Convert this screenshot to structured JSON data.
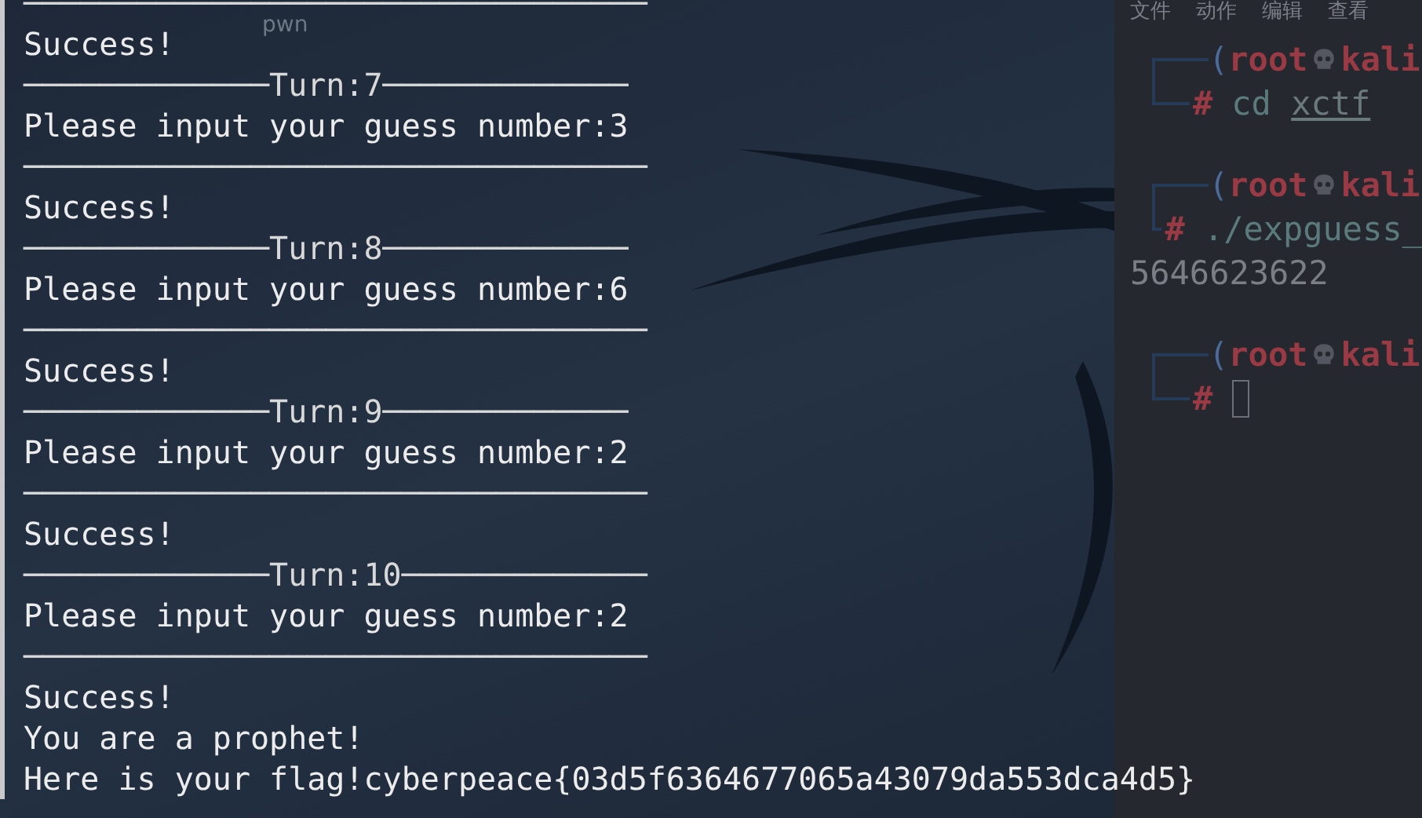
{
  "desktop": {
    "icon_labels": [
      {
        "label": "pwn"
      }
    ]
  },
  "terminal": {
    "lines": [
      {
        "kind": "rule",
        "text": "─────────────────────────────────"
      },
      {
        "kind": "text",
        "text": "Success!"
      },
      {
        "kind": "rule",
        "text": "─────────────Turn:7─────────────"
      },
      {
        "kind": "text",
        "text": "Please input your guess number:3"
      },
      {
        "kind": "rule",
        "text": "─────────────────────────────────"
      },
      {
        "kind": "text",
        "text": "Success!"
      },
      {
        "kind": "rule",
        "text": "─────────────Turn:8─────────────"
      },
      {
        "kind": "text",
        "text": "Please input your guess number:6"
      },
      {
        "kind": "rule",
        "text": "─────────────────────────────────"
      },
      {
        "kind": "text",
        "text": "Success!"
      },
      {
        "kind": "rule",
        "text": "─────────────Turn:9─────────────"
      },
      {
        "kind": "text",
        "text": "Please input your guess number:2"
      },
      {
        "kind": "rule",
        "text": "─────────────────────────────────"
      },
      {
        "kind": "text",
        "text": "Success!"
      },
      {
        "kind": "rule",
        "text": "─────────────Turn:10─────────────"
      },
      {
        "kind": "text",
        "text": "Please input your guess number:2"
      },
      {
        "kind": "rule",
        "text": "─────────────────────────────────"
      },
      {
        "kind": "text",
        "text": "Success!"
      },
      {
        "kind": "text",
        "text": "You are a prophet!"
      },
      {
        "kind": "text",
        "text": "Here is your flag!cyberpeace{03d5f6364677065a43079da553dca4d5}"
      }
    ]
  },
  "second_terminal": {
    "menu": [
      "文件",
      "动作",
      "编辑",
      "查看"
    ],
    "blocks": [
      {
        "prompt": {
          "open": "(",
          "user": "root",
          "host": "kali"
        },
        "command": "cd ",
        "argument": "xctf"
      },
      {
        "prompt": {
          "open": "(",
          "user": "root",
          "host": "kali"
        },
        "command": "./expguess_",
        "output": "5646623622"
      },
      {
        "prompt": {
          "open": "(",
          "user": "root",
          "host": "kali"
        },
        "cursor": true
      }
    ],
    "hash": "#"
  }
}
